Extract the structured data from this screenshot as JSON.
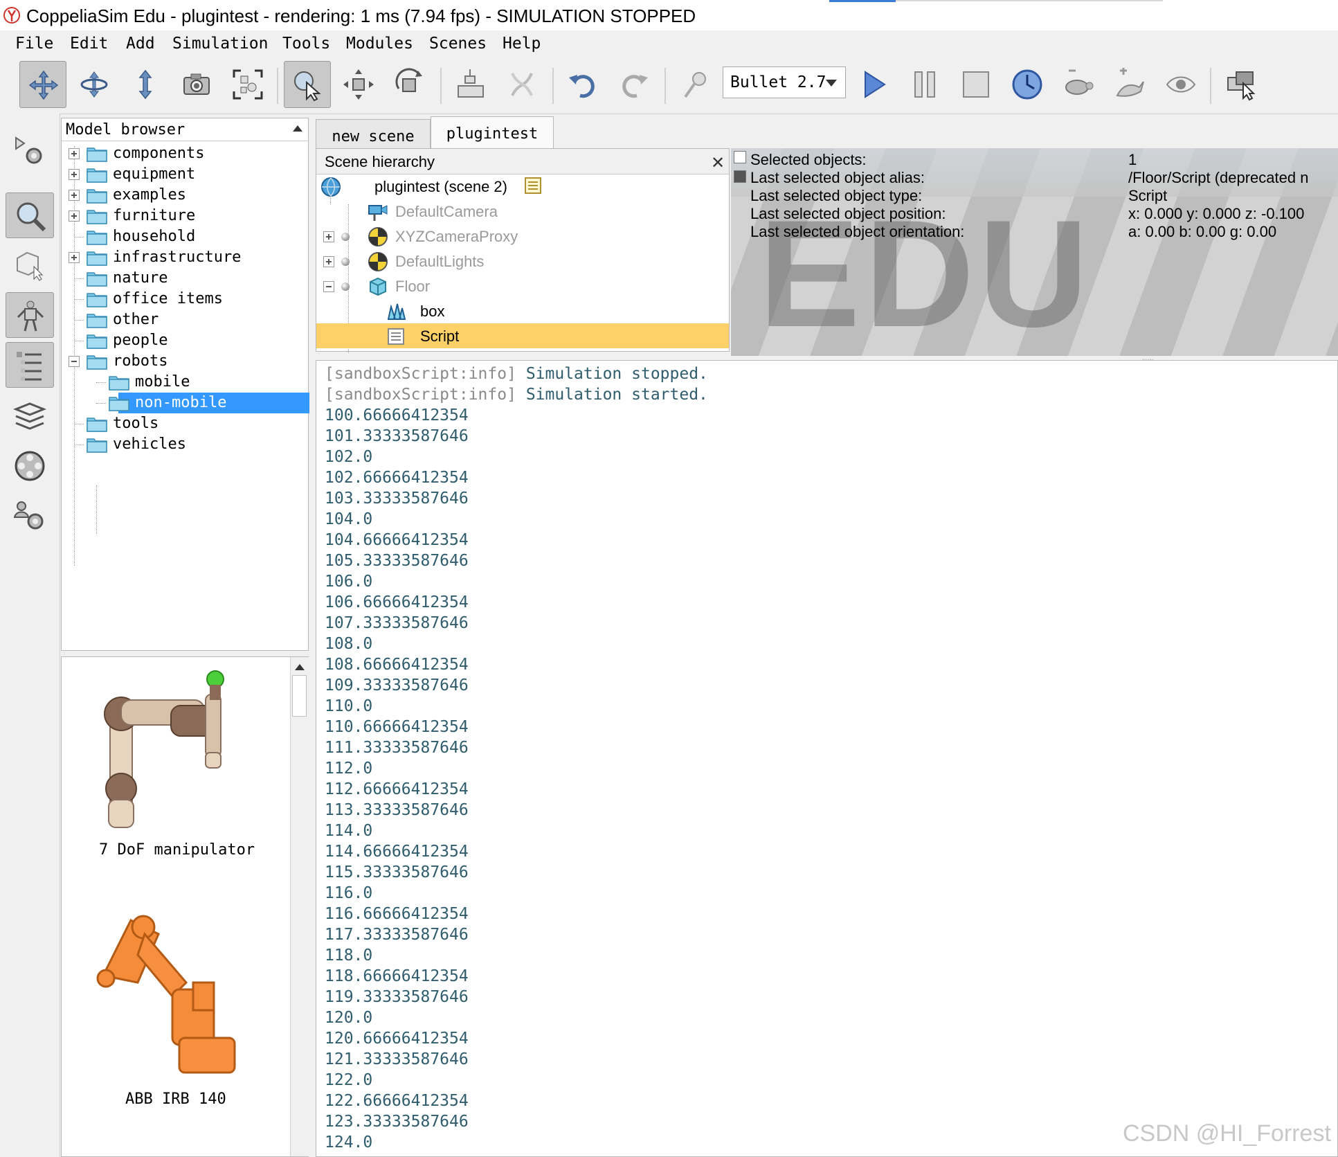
{
  "window": {
    "title": "CoppeliaSim Edu - plugintest - rendering: 1 ms (7.94 fps) - SIMULATION STOPPED"
  },
  "menu": [
    "File",
    "Edit",
    "Add",
    "Simulation",
    "Tools",
    "Modules",
    "Scenes",
    "Help"
  ],
  "toolbar": {
    "engine": "Bullet 2.7"
  },
  "model_browser": {
    "title": "Model browser",
    "items": [
      {
        "label": "components",
        "expandable": true
      },
      {
        "label": "equipment",
        "expandable": true
      },
      {
        "label": "examples",
        "expandable": true
      },
      {
        "label": "furniture",
        "expandable": true
      },
      {
        "label": "household",
        "expandable": false
      },
      {
        "label": "infrastructure",
        "expandable": true
      },
      {
        "label": "nature",
        "expandable": false
      },
      {
        "label": "office items",
        "expandable": false
      },
      {
        "label": "other",
        "expandable": false
      },
      {
        "label": "people",
        "expandable": false
      },
      {
        "label": "robots",
        "expandable": true,
        "expanded": true
      },
      {
        "label": "mobile",
        "child": true
      },
      {
        "label": "non-mobile",
        "child": true,
        "selected": true
      },
      {
        "label": "tools",
        "expandable": false
      },
      {
        "label": "vehicles",
        "expandable": false
      }
    ],
    "thumbnails": [
      "7 DoF manipulator",
      "ABB IRB 140"
    ]
  },
  "tabs": [
    "new scene",
    "plugintest"
  ],
  "scene_hierarchy": {
    "title": "Scene hierarchy",
    "close": "✕",
    "items": [
      {
        "label": "plugintest (scene 2)"
      },
      {
        "label": "DefaultCamera"
      },
      {
        "label": "XYZCameraProxy"
      },
      {
        "label": "DefaultLights"
      },
      {
        "label": "Floor"
      },
      {
        "label": "box"
      },
      {
        "label": "Script"
      }
    ]
  },
  "viewport": {
    "watermark": "EDU",
    "info_labels": [
      "Selected objects:",
      "Last selected object alias:",
      "Last selected object type:",
      "Last selected object position:",
      "Last selected object orientation:"
    ],
    "info_values": [
      "1",
      "/Floor/Script    (deprecated n",
      "Script",
      "x: 0.000    y: 0.000    z: -0.100",
      "a: 0.00     b: 0.00     g: 0.00"
    ]
  },
  "console": {
    "tag": "[sandboxScript:info]",
    "messages": [
      "Simulation stopped.",
      "Simulation started."
    ],
    "values": [
      "100.66666412354",
      "101.33333587646",
      "102.0",
      "102.66666412354",
      "103.33333587646",
      "104.0",
      "104.66666412354",
      "105.33333587646",
      "106.0",
      "106.66666412354",
      "107.33333587646",
      "108.0",
      "108.66666412354",
      "109.33333587646",
      "110.0",
      "110.66666412354",
      "111.33333587646",
      "112.0",
      "112.66666412354",
      "113.33333587646",
      "114.0",
      "114.66666412354",
      "115.33333587646",
      "116.0",
      "116.66666412354",
      "117.33333587646",
      "118.0",
      "118.66666412354",
      "119.33333587646",
      "120.0",
      "120.66666412354",
      "121.33333587646",
      "122.0",
      "122.66666412354",
      "123.33333587646",
      "124.0"
    ]
  },
  "watermark": "CSDN @HI_Forrest",
  "colors": {
    "selection_blue": "#3399ff",
    "selection_yellow": "#fdd068",
    "folder": "#7ec8e8",
    "console_text": "#2f5d6e",
    "play_accent": "#3a6fc8"
  },
  "icons": {
    "toolbar": [
      "move-view-icon",
      "rotate-view-icon",
      "shift-view-icon",
      "camera-icon",
      "fit-view-icon",
      "select-icon",
      "object-move-icon",
      "object-rotate-icon",
      "assemble-icon",
      "transfer-dna-icon",
      "undo-icon",
      "redo-icon",
      "dynamics-icon",
      "play-icon",
      "pause-icon",
      "stop-icon",
      "realtime-icon",
      "slow-down-icon",
      "speed-up-icon",
      "visualization-icon",
      "toggle-window-icon"
    ],
    "left": [
      "sim-settings-icon",
      "magnifier-icon",
      "shape-edit-icon",
      "robot-icon",
      "hierarchy-icon",
      "layers-icon",
      "film-icon",
      "user-settings-icon"
    ]
  }
}
